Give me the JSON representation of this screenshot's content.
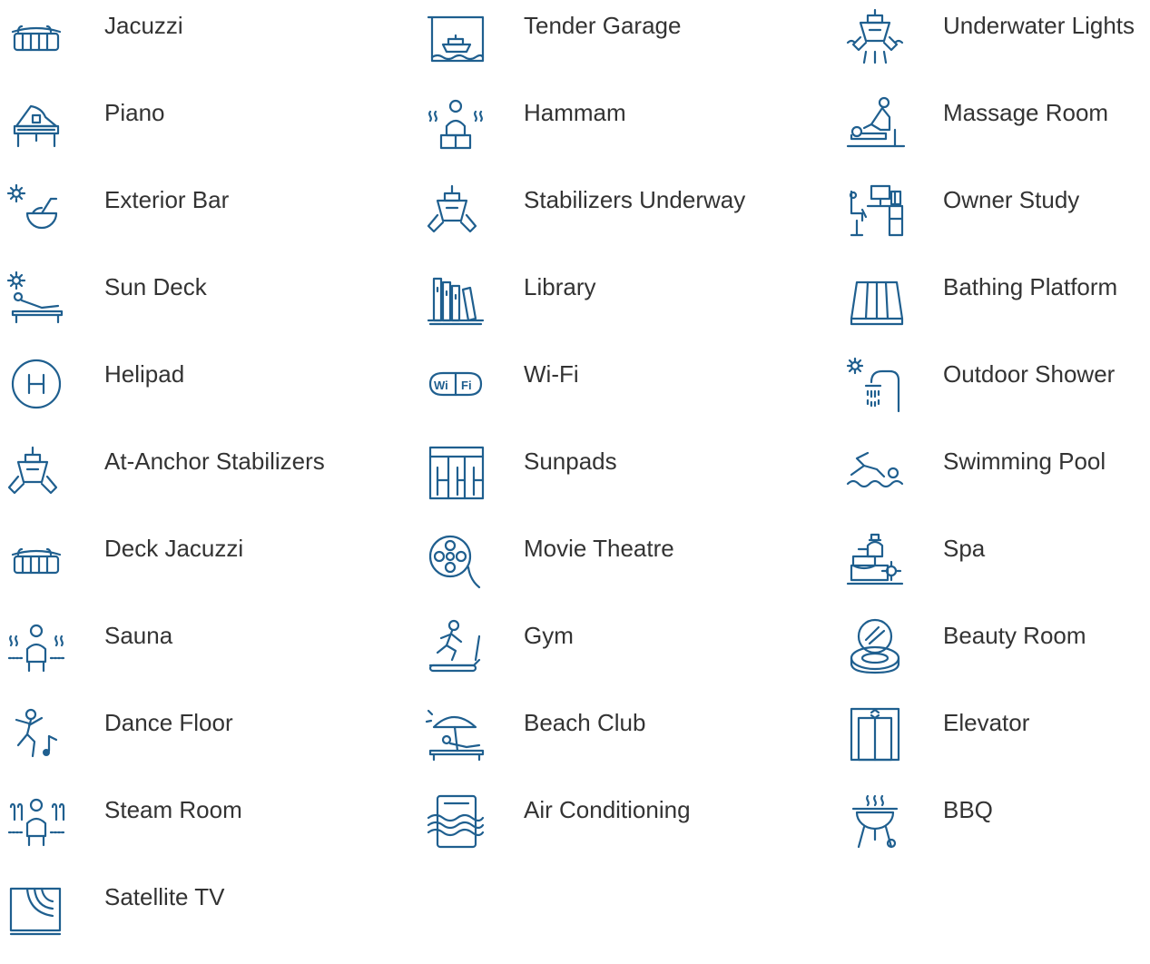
{
  "accent": "#1f5f8f",
  "text_color": "#333333",
  "columns": [
    [
      {
        "label": "Jacuzzi",
        "icon": "jacuzzi-icon"
      },
      {
        "label": "Piano",
        "icon": "piano-icon"
      },
      {
        "label": "Exterior Bar",
        "icon": "cocktail-icon"
      },
      {
        "label": "Sun Deck",
        "icon": "sun-lounger-icon"
      },
      {
        "label": "Helipad",
        "icon": "helipad-icon"
      },
      {
        "label": "At-Anchor Stabilizers",
        "icon": "boat-stabilizer-icon"
      },
      {
        "label": "Deck Jacuzzi",
        "icon": "jacuzzi-icon"
      },
      {
        "label": "Sauna",
        "icon": "sauna-icon"
      },
      {
        "label": "Dance Floor",
        "icon": "dancer-icon"
      },
      {
        "label": "Steam Room",
        "icon": "steam-room-icon"
      },
      {
        "label": "Satellite TV",
        "icon": "satellite-icon"
      }
    ],
    [
      {
        "label": "Tender Garage",
        "icon": "tender-garage-icon"
      },
      {
        "label": "Hammam",
        "icon": "hammam-icon"
      },
      {
        "label": "Stabilizers Underway",
        "icon": "boat-stabilizer-icon"
      },
      {
        "label": "Library",
        "icon": "bookshelf-icon"
      },
      {
        "label": "Wi-Fi",
        "icon": "wifi-icon"
      },
      {
        "label": "Sunpads",
        "icon": "sunpads-icon"
      },
      {
        "label": "Movie Theatre",
        "icon": "film-reel-icon"
      },
      {
        "label": "Gym",
        "icon": "treadmill-icon"
      },
      {
        "label": "Beach Club",
        "icon": "beach-umbrella-icon"
      },
      {
        "label": "Air Conditioning",
        "icon": "air-conditioning-icon"
      }
    ],
    [
      {
        "label": "Underwater Lights",
        "icon": "underwater-lights-icon"
      },
      {
        "label": "Massage Room",
        "icon": "massage-icon"
      },
      {
        "label": "Owner Study",
        "icon": "desk-icon"
      },
      {
        "label": "Bathing Platform",
        "icon": "bathing-platform-icon"
      },
      {
        "label": "Outdoor Shower",
        "icon": "shower-icon"
      },
      {
        "label": "Swimming Pool",
        "icon": "swimmer-icon"
      },
      {
        "label": "Spa",
        "icon": "spa-bottles-icon"
      },
      {
        "label": "Beauty Room",
        "icon": "compact-mirror-icon"
      },
      {
        "label": "Elevator",
        "icon": "elevator-icon"
      },
      {
        "label": "BBQ",
        "icon": "bbq-grill-icon"
      }
    ]
  ]
}
